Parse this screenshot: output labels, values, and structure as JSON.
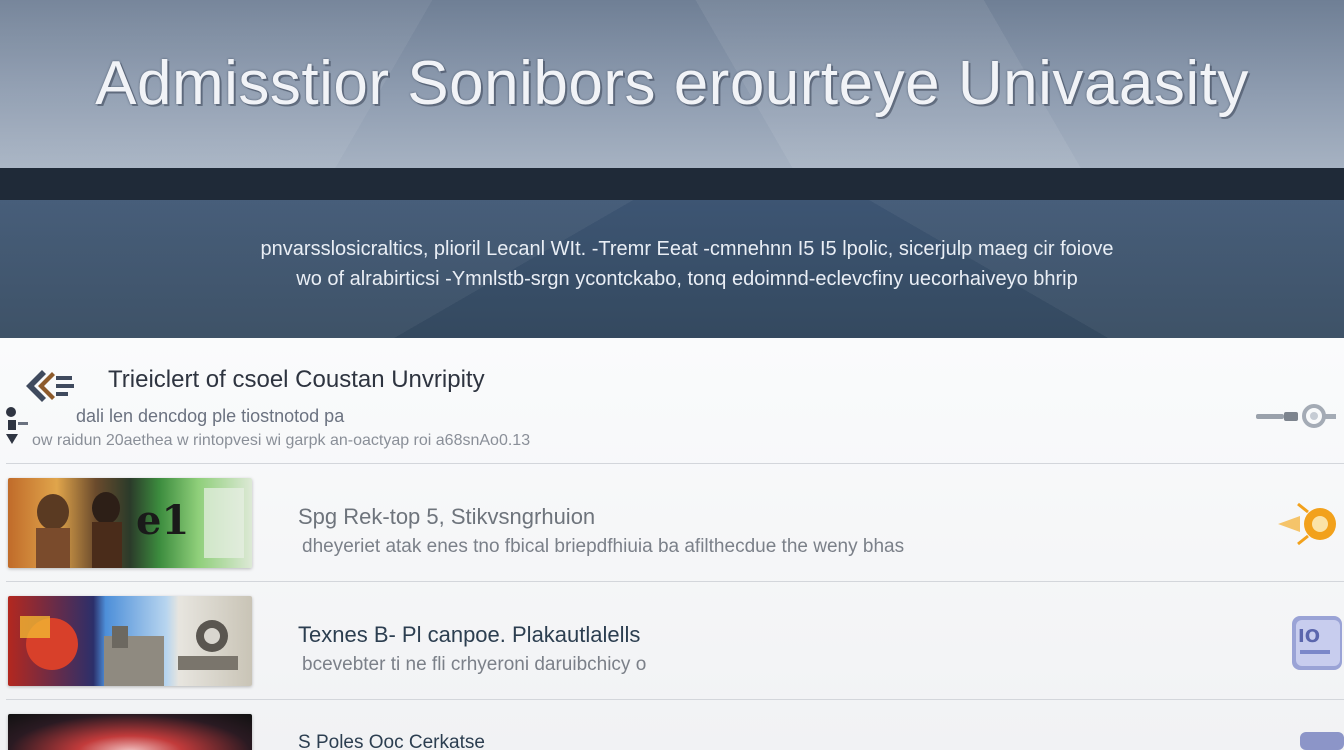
{
  "header": {
    "title": "Admisstior Sonibors erourteye Univaasity"
  },
  "intro": {
    "line1": "pnvarsslosicraltics, plioril Lecanl WIt. -Tremr Eeat -cmnehnn I5 I5 lpolic, sicerjulp maeg cir foiove",
    "line2": "wo of alrabirticsi -Ymnlstb-srgn ycontckabo, tonq edoimnd-eclevcfiny uecorhaiveyo bhrip"
  },
  "featured": {
    "title": "Trieiclert of csoel Coustan Unvripity",
    "sub1": "dali len dencdog ple tiostnotod pa",
    "sub2": "ow raidun 20aethea w rintopvesi wi garpk an-oactyap roi a68snAo0.13"
  },
  "items": [
    {
      "title": "Spg Rek-top 5, Stikvsngrhuion",
      "desc": "dheyeriet atak enes tno fbical briepdfhiuia ba afilthecdue the weny bhas"
    },
    {
      "title": "Texnes B- Pl canpoe. Plakautlalells",
      "desc": "bcevebter ti ne fli crhyeroni daruibchicy o"
    },
    {
      "title": "S Poles Ooc Cerkatse"
    }
  ],
  "icons": {
    "featured_logo": "university-crest-icon",
    "featured_side": "side-ornament-icon",
    "featured_action": "arrow-link-icon",
    "item1_action": "sun-badge-icon",
    "item2_action": "document-badge-icon",
    "item3_action": "partial-badge-icon"
  },
  "colors": {
    "banner": "#8e9cb0",
    "intro": "#3d5573",
    "strip": "#1f2a38",
    "accent_orange": "#f2a11c",
    "accent_blue": "#7b87c9"
  }
}
